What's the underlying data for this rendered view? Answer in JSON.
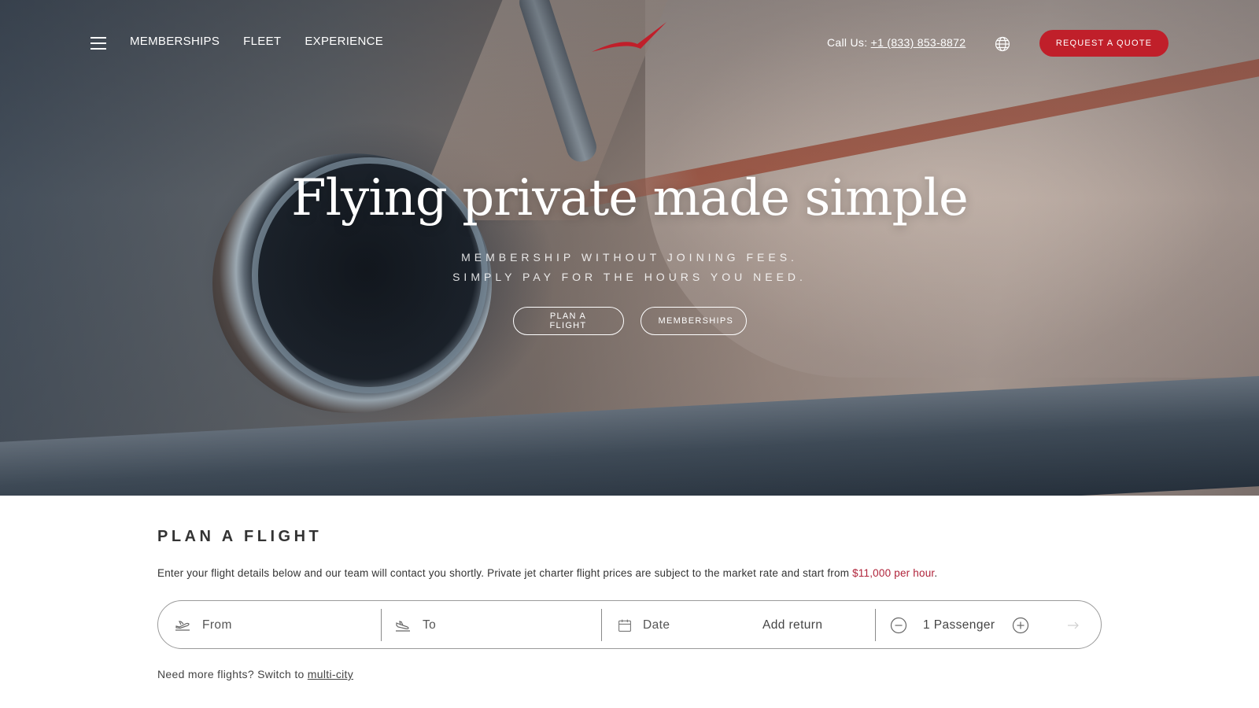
{
  "nav": {
    "links": [
      "MEMBERSHIPS",
      "FLEET",
      "EXPERIENCE"
    ],
    "call_prefix": "Call Us:",
    "phone": "+1 (833) 853-8872",
    "quote_button": "REQUEST A QUOTE"
  },
  "hero": {
    "title": "Flying private made simple",
    "subtitle_line1": "MEMBERSHIP WITHOUT JOINING FEES.",
    "subtitle_line2": "SIMPLY PAY FOR THE HOURS YOU NEED.",
    "button_plan": "PLAN A FLIGHT",
    "button_memberships": "MEMBERSHIPS"
  },
  "plan": {
    "title": "PLAN A FLIGHT",
    "description": "Enter your flight details below and our team will contact you shortly. Private jet charter flight prices are subject to the market rate and start from ",
    "price": "$11,000 per hour",
    "description_end": ".",
    "from_placeholder": "From",
    "to_placeholder": "To",
    "date_placeholder": "Date",
    "add_return": "Add return",
    "passengers": "1 Passenger",
    "multi_prefix": "Need more flights? Switch to ",
    "multi_link": "multi-city"
  },
  "colors": {
    "accent": "#c01f2a",
    "price": "#b0233a"
  },
  "icons": [
    "menu-icon",
    "logo-bird-icon",
    "globe-icon",
    "departure-icon",
    "arrival-icon",
    "calendar-icon",
    "minus-circle-icon",
    "plus-circle-icon",
    "arrow-right-icon"
  ]
}
